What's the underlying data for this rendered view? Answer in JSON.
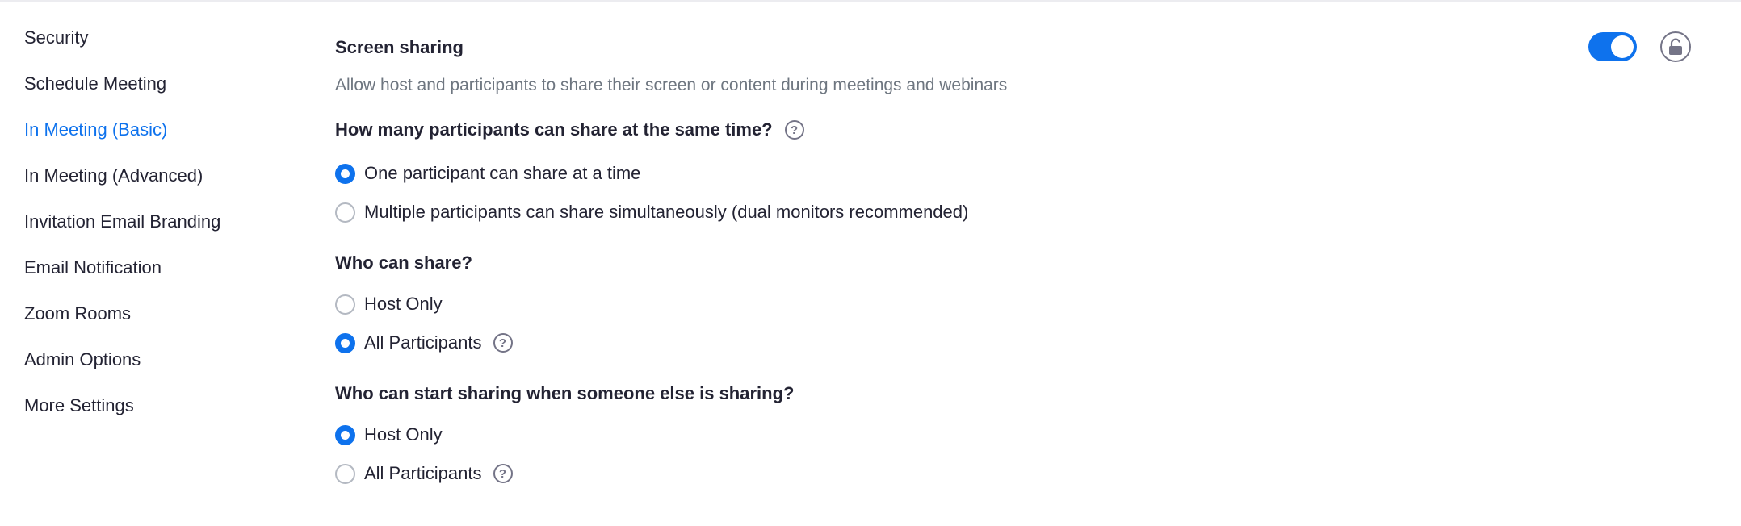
{
  "sidebar": {
    "items": [
      {
        "label": "Security"
      },
      {
        "label": "Schedule Meeting"
      },
      {
        "label": "In Meeting (Basic)",
        "active": true
      },
      {
        "label": "In Meeting (Advanced)"
      },
      {
        "label": "Invitation Email Branding"
      },
      {
        "label": "Email Notification"
      },
      {
        "label": "Zoom Rooms"
      },
      {
        "label": "Admin Options"
      },
      {
        "label": "More Settings"
      }
    ]
  },
  "setting": {
    "title": "Screen sharing",
    "description": "Allow host and participants to share their screen or content during meetings and webinars",
    "enabled": true,
    "toggle_icon": "toggle-on",
    "lock_icon": "unlocked-icon",
    "help_glyph": "?"
  },
  "groups": [
    {
      "question": "How many participants can share at the same time?",
      "options": [
        {
          "label": "One participant can share at a time",
          "checked": true
        },
        {
          "label": "Multiple participants can share simultaneously (dual monitors recommended)",
          "checked": false
        }
      ]
    },
    {
      "question": "Who can share?",
      "options": [
        {
          "label": "Host Only",
          "checked": false
        },
        {
          "label": "All Participants",
          "checked": true
        }
      ]
    },
    {
      "question": "Who can start sharing when someone else is sharing?",
      "options": [
        {
          "label": "Host Only",
          "checked": true
        },
        {
          "label": "All Participants",
          "checked": false
        }
      ]
    }
  ],
  "colors": {
    "accent": "#0e72ed",
    "text": "#232333",
    "muted": "#6e7680"
  }
}
